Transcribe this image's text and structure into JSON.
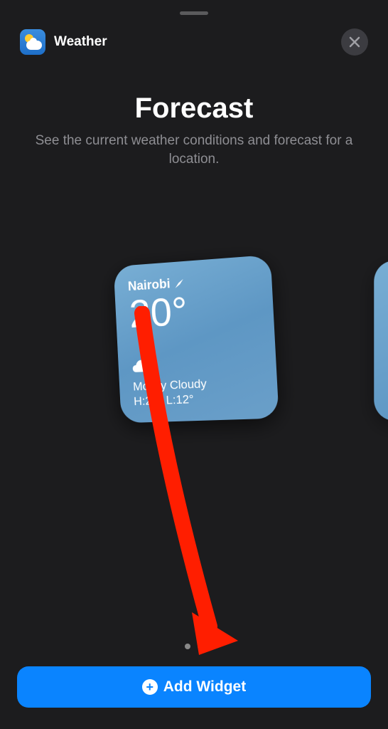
{
  "header": {
    "app_name": "Weather"
  },
  "title": "Forecast",
  "subtitle": "See the current weather conditions and forecast for a location.",
  "widget": {
    "location": "Nairobi",
    "temperature": "20°",
    "condition": "Mostly Cloudy",
    "high_low": "H:21° L:12°"
  },
  "add_button_label": "Add Widget"
}
